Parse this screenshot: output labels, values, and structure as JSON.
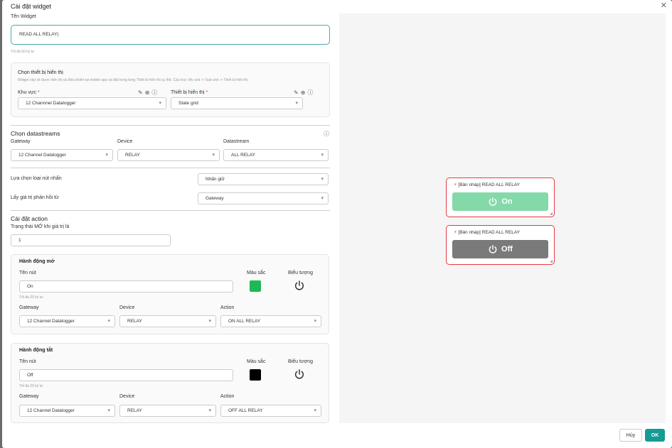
{
  "dialog": {
    "title": "Cài đặt widget"
  },
  "widget_name": {
    "label": "Tên Widget",
    "value": "READ ALL RELAY",
    "hint": "Tối đa 50 ký tự"
  },
  "device_display": {
    "title": "Chọn thiết bị hiển thị",
    "description": "Widget này sẽ được hiển thị và điều khiển tại mobile app và đặt trong từng Thiết bị hiển thị cụ thể. Cấu trúc: My unit -> Sub-unit -> Thiết bị hiển thị",
    "area_label": "Khu vực",
    "area_value": "12 Channnel Datalogger",
    "display_label": "Thiết bị hiển thị",
    "display_value": "State grid",
    "required_mark": "*"
  },
  "datastreams": {
    "title": "Chọn datastreams",
    "gateway_label": "Gateway",
    "gateway_value": "12 Channel Datalogger",
    "device_label": "Device",
    "device_value": "RELAY",
    "datastream_label": "Datastream",
    "datastream_value": "ALL RELAY"
  },
  "button_type": {
    "label": "Lựa chọn loại nút nhấn",
    "value": "Nhấn giữ"
  },
  "feedback": {
    "label": "Lấy giá trị phản hồi từ",
    "value": "Gateway"
  },
  "action": {
    "title": "Cài đặt action",
    "on_value_label": "Trạng thái MỞ khi giá trị là",
    "on_value": "1"
  },
  "open_action": {
    "title": "Hành động mở",
    "name_label": "Tên nút",
    "name_value": "On",
    "name_hint": "Tối đa 20 ký tự",
    "color_label": "Màu sắc",
    "color": "#1db954",
    "icon_label": "Biểu tượng",
    "icon": "power-icon",
    "gateway_label": "Gateway",
    "gateway_value": "12 Channel Datalogger",
    "device_label": "Device",
    "device_value": "RELAY",
    "action_label": "Action",
    "action_value": "ON ALL RELAY"
  },
  "close_action": {
    "title": "Hành động tắt",
    "name_label": "Tên nút",
    "name_value": "Off",
    "name_hint": "Tối đa 20 ký tự",
    "color_label": "Màu sắc",
    "color": "#000000",
    "icon_label": "Biểu tượng",
    "icon": "power-icon",
    "gateway_label": "Gateway",
    "gateway_value": "12 Channel Datalogger",
    "device_label": "Device",
    "device_value": "RELAY",
    "action_label": "Action",
    "action_value": "OFF ALL RELAY"
  },
  "preview": {
    "on_card": {
      "caption": "[Bản nháp] READ ALL RELAY",
      "button_label": "On",
      "color": "#84d9a8"
    },
    "off_card": {
      "caption": "[Bản nháp] READ ALL RELAY",
      "button_label": "Off",
      "color": "#7a7a7a"
    },
    "border_color": "#e63946"
  },
  "footer": {
    "cancel_label": "Hủy",
    "ok_label": "OK",
    "ok_color": "#149b96"
  }
}
